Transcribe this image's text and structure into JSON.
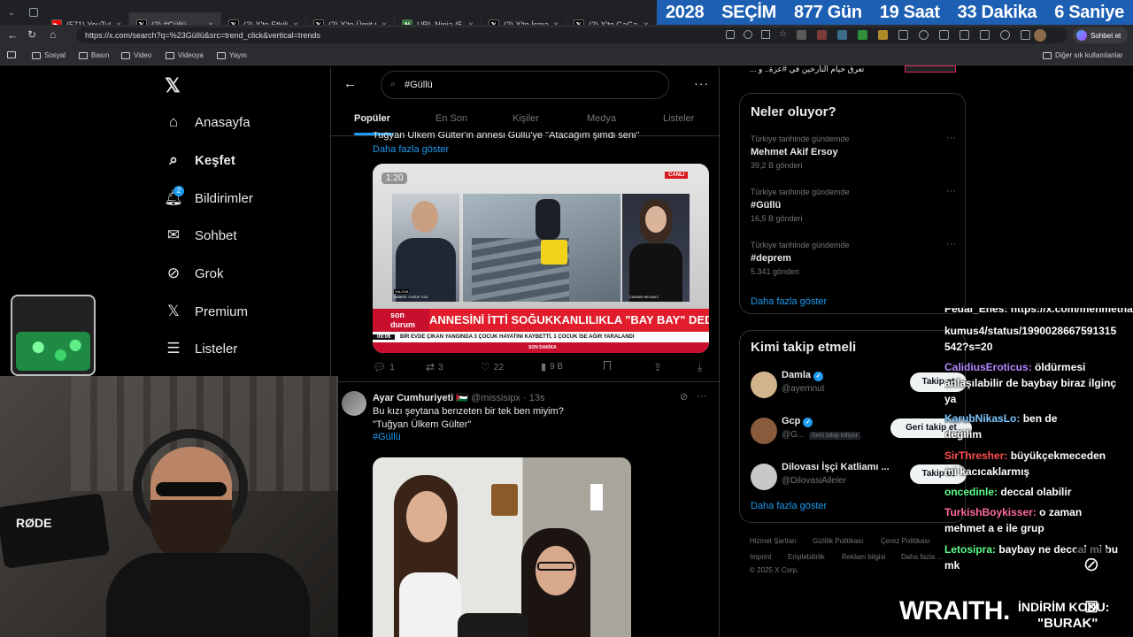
{
  "browser": {
    "tabs": [
      {
        "icon": "youtube-icon",
        "title": "(571) YouTube",
        "color": "#ff0000"
      },
      {
        "icon": "x-icon",
        "title": "(2) #Güllü - ",
        "color": "#000000",
        "active": true
      },
      {
        "icon": "x-icon",
        "title": "(2) X'te Etkili Hal",
        "color": "#000000"
      },
      {
        "icon": "x-icon",
        "title": "(2) X'te Ümit Özd",
        "color": "#000000"
      },
      {
        "icon": "ninja-icon",
        "title": "URL Ninja (51)",
        "color": "#2e7d32"
      },
      {
        "icon": "x-icon",
        "title": "(2) X'te İsmail Ar",
        "color": "#000000"
      },
      {
        "icon": "x-icon",
        "title": "(2) X'te GaGa Hal",
        "color": "#000000"
      }
    ],
    "countdown": {
      "year": "2028",
      "label": "SEÇİM",
      "days": "877 Gün",
      "hours": "19 Saat",
      "minutes": "33 Dakika",
      "seconds": "6 Saniye"
    },
    "url": "https://x.com/search?q=%23Güllü&src=trend_click&vertical=trends",
    "chat_button": "Sohbet et",
    "bookmarks": [
      "Sosyal",
      "Basın",
      "Video",
      "Videoya",
      "Yayın"
    ],
    "other_bookmarks": "Diğer sık kullanılanlar"
  },
  "nav": {
    "items": [
      {
        "label": "Anasayfa",
        "icon": "home-icon"
      },
      {
        "label": "Keşfet",
        "icon": "search-icon",
        "active": true
      },
      {
        "label": "Bildirimler",
        "icon": "bell-icon",
        "badge": "2"
      },
      {
        "label": "Sohbet",
        "icon": "mail-icon"
      },
      {
        "label": "Grok",
        "icon": "grok-icon"
      },
      {
        "label": "Premium",
        "icon": "x-logo-icon"
      },
      {
        "label": "Listeler",
        "icon": "list-icon"
      }
    ]
  },
  "search": {
    "query": "#Güllü",
    "tabs": [
      "Popüler",
      "En Son",
      "Kişiler",
      "Medya",
      "Listeler"
    ]
  },
  "tweet1": {
    "text_partial": "Tuğyan Ülkem Gülter'in annesi Güllü'ye \"Atacağım şimdi seni\"",
    "show_more": "Daha fazla göster",
    "video": {
      "duration": "1:20",
      "live_badge": "CANLI",
      "reporter_caption1": "HABER: YUSUF GÜL",
      "reporter_caption2": "GÖRÜNTÜ: KENAN ARDA GÜL",
      "location": "YALOVA",
      "anchor_caption": "CANSIN HELVACI",
      "brand_top": "son",
      "brand_bottom": "durum",
      "headline": "ANNESİNİ İTTİ SOĞUKKANLILIKLA \"BAY BAY\" DEDİ",
      "ticker_time": "09:06",
      "ticker": "BİR EVDE ÇIKAN YANGINDA 3 ÇOCUK HAYATINI KAYBETTİ, 1 ÇOCUK İSE AĞIR YARALANDI",
      "ticker_label": "SON DAKİKA",
      "channel": "Son Dakika"
    },
    "stats": {
      "replies": "1",
      "retweets": "3",
      "likes": "22",
      "views": "9 B"
    }
  },
  "tweet2": {
    "name": "Ayar Cumhuriyeti",
    "flag": "🇵🇸",
    "handle": "@missisipx",
    "time": "13s",
    "line1": "Bu kızı şeytana benzeten bir tek ben miyim?",
    "line2": "\"Tuğyan Ülkem Gülter\"",
    "hashtag": "#Güllü"
  },
  "trends": {
    "top_partial": "... تعرق حيام التارخين في #عزة.. و",
    "title": "Neler oluyor?",
    "items": [
      {
        "meta": "Türkiye tarihinde gündemde",
        "name": "Mehmet Akif Ersoy",
        "count": "39,2 B gönderi"
      },
      {
        "meta": "Türkiye tarihinde gündemde",
        "name": "#Güllü",
        "count": "16,5 B gönderi"
      },
      {
        "meta": "Türkiye tarihinde gündemde",
        "name": "#deprem",
        "count": "5.341 gönderi"
      }
    ],
    "show_more": "Daha fazla göster"
  },
  "who_to_follow": {
    "title": "Kimi takip etmeli",
    "items": [
      {
        "name": "Damla",
        "handle": "@ayemnut",
        "button": "Takip et",
        "verified": true
      },
      {
        "name": "Gcp",
        "handle": "@G...",
        "follows_you": "Seni takip ediyor",
        "button": "Geri takip et",
        "verified": true
      },
      {
        "name": "Dilovası İşçi Katliamı ...",
        "handle": "@DilovasiAileler",
        "button": "Takip et",
        "verified": false
      }
    ],
    "show_more": "Daha fazla göster"
  },
  "footer": {
    "links": [
      "Hizmet Şartları",
      "Gizlilik Politikası",
      "Çerez Politikası",
      "Imprint",
      "Erişilebilirlik",
      "Reklam bilgisi",
      "Daha fazla ..."
    ],
    "copyright": "© 2025 X Corp."
  },
  "chat": [
    {
      "user": "Pedal_Enes",
      "text": "https://x.com/mehmethat",
      "color": "#ffffff",
      "partial": true
    },
    {
      "user": "",
      "text": "kumus4/status/1990028667591315",
      "color": "#ffffff"
    },
    {
      "user": "",
      "text": "542?s=20",
      "color": "#ffffff"
    },
    {
      "user": "CalidiusEroticus",
      "text": "öldürmesi",
      "color": "#b388ff"
    },
    {
      "user": "",
      "text": "anlaşılabilir de baybay biraz ilginç",
      "color": "#ffffff"
    },
    {
      "user": "",
      "text": "ya",
      "color": "#ffffff"
    },
    {
      "user": "KarubNikasLo",
      "text": "ben de",
      "color": "#7ec8ff"
    },
    {
      "user": "",
      "text": "değilim",
      "color": "#ffffff"
    },
    {
      "user": "SirThresher",
      "text": "büyükçekmeceden",
      "color": "#ff4d4d"
    },
    {
      "user": "",
      "text": "mi kacıcaklarmış",
      "color": "#ffffff"
    },
    {
      "user": "oncedinle",
      "text": "deccal olabilir",
      "color": "#5cff8a"
    },
    {
      "user": "TurkishBoykisser",
      "text": "o zaman",
      "color": "#ff6b9d"
    },
    {
      "user": "",
      "text": "mehmet a e ile grup",
      "color": "#ffffff"
    },
    {
      "user": "Letosipra",
      "text": "baybay ne deccal mi bu",
      "color": "#5cff8a"
    },
    {
      "user": "",
      "text": "mk",
      "color": "#ffffff"
    }
  ],
  "sponsor": {
    "brand": "WRAITH.",
    "code_label": "İNDİRİM KODU:",
    "code": "\"BURAK\""
  },
  "webcam": {
    "mic_brand": "RØDE"
  }
}
